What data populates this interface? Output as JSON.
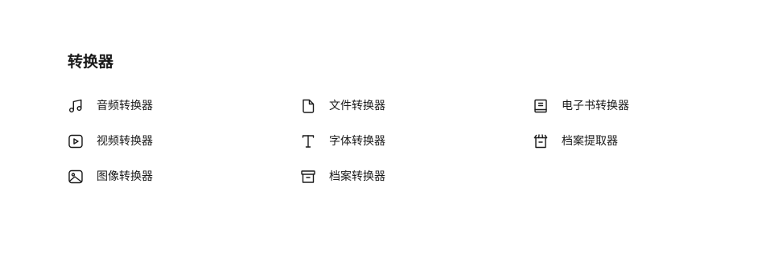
{
  "converters": {
    "title": "转换器",
    "items": [
      {
        "label": "音频转换器",
        "icon": "music-note-icon"
      },
      {
        "label": "文件转换器",
        "icon": "document-icon"
      },
      {
        "label": "电子书转换器",
        "icon": "ebook-icon"
      },
      {
        "label": "视频转换器",
        "icon": "video-play-icon"
      },
      {
        "label": "字体转换器",
        "icon": "font-icon"
      },
      {
        "label": "档案提取器",
        "icon": "archive-extract-icon"
      },
      {
        "label": "图像转换器",
        "icon": "image-icon"
      },
      {
        "label": "档案转换器",
        "icon": "archive-box-icon"
      }
    ]
  }
}
